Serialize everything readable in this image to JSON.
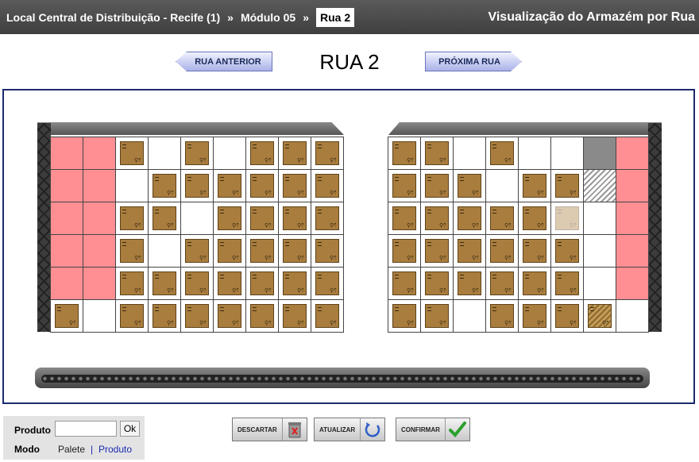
{
  "header": {
    "breadcrumb": [
      {
        "label": "Local Central de Distribuição - Recife (1)"
      },
      {
        "label": "Módulo 05"
      },
      {
        "label": "Rua 2"
      }
    ],
    "separator": "»",
    "page_title": "Visualização do Armazém por Rua"
  },
  "nav": {
    "prev_label": "RUA ANTERIOR",
    "next_label": "PRÓXIMA RUA",
    "street_title": "RUA 2"
  },
  "cell_legend": {
    "empty": "empty slot",
    "box": "stored box",
    "blocked": "blocked slot (red)",
    "gray": "unavailable slot (gray)",
    "hatch": "hatched / reserved slot",
    "faded": "faded box",
    "hatched_box": "hatched box"
  },
  "racks": {
    "left": [
      [
        "blocked",
        "blocked",
        "box",
        "empty",
        "box",
        "empty",
        "box",
        "box",
        "box"
      ],
      [
        "blocked",
        "blocked",
        "empty",
        "box",
        "box",
        "box",
        "box",
        "box",
        "box"
      ],
      [
        "blocked",
        "blocked",
        "box",
        "box",
        "empty",
        "box",
        "box",
        "box",
        "box"
      ],
      [
        "blocked",
        "blocked",
        "box",
        "empty",
        "box",
        "box",
        "box",
        "box",
        "box"
      ],
      [
        "blocked",
        "blocked",
        "box",
        "box",
        "box",
        "box",
        "box",
        "box",
        "box"
      ],
      [
        "box",
        "empty",
        "box",
        "box",
        "box",
        "box",
        "box",
        "box",
        "box"
      ]
    ],
    "right": [
      [
        "box",
        "box",
        "empty",
        "box",
        "empty",
        "empty",
        "gray",
        "blocked",
        "empty"
      ],
      [
        "box",
        "box",
        "box",
        "empty",
        "box",
        "box",
        "hatch",
        "blocked",
        "empty"
      ],
      [
        "box",
        "box",
        "box",
        "box",
        "box",
        "faded",
        "empty",
        "blocked",
        "empty"
      ],
      [
        "box",
        "box",
        "box",
        "box",
        "box",
        "box",
        "empty",
        "blocked",
        "empty"
      ],
      [
        "box",
        "box",
        "box",
        "box",
        "box",
        "box",
        "empty",
        "blocked",
        "empty"
      ],
      [
        "box",
        "box",
        "empty",
        "box",
        "box",
        "box",
        "hatched_box",
        "empty",
        "empty"
      ]
    ]
  },
  "colors": {
    "header_bg": "#4a4a4a",
    "frame_border": "#1c2a6e",
    "blocked": "#ff8f93",
    "box": "#a97d3e",
    "mode_selected": "#1a2ab0"
  },
  "panel": {
    "product_label": "Produto",
    "product_value": "",
    "ok_label": "Ok",
    "mode_label": "Modo",
    "mode_pallet": "Palete",
    "mode_sep": "|",
    "mode_product": "Produto",
    "mode_selected": "Produto"
  },
  "actions": {
    "discard": {
      "label": "DESCARTAR",
      "icon": "trash-icon"
    },
    "refresh": {
      "label": "ATUALIZAR",
      "icon": "refresh-icon"
    },
    "confirm": {
      "label": "CONFIRMAR",
      "icon": "checkmark-icon"
    }
  }
}
